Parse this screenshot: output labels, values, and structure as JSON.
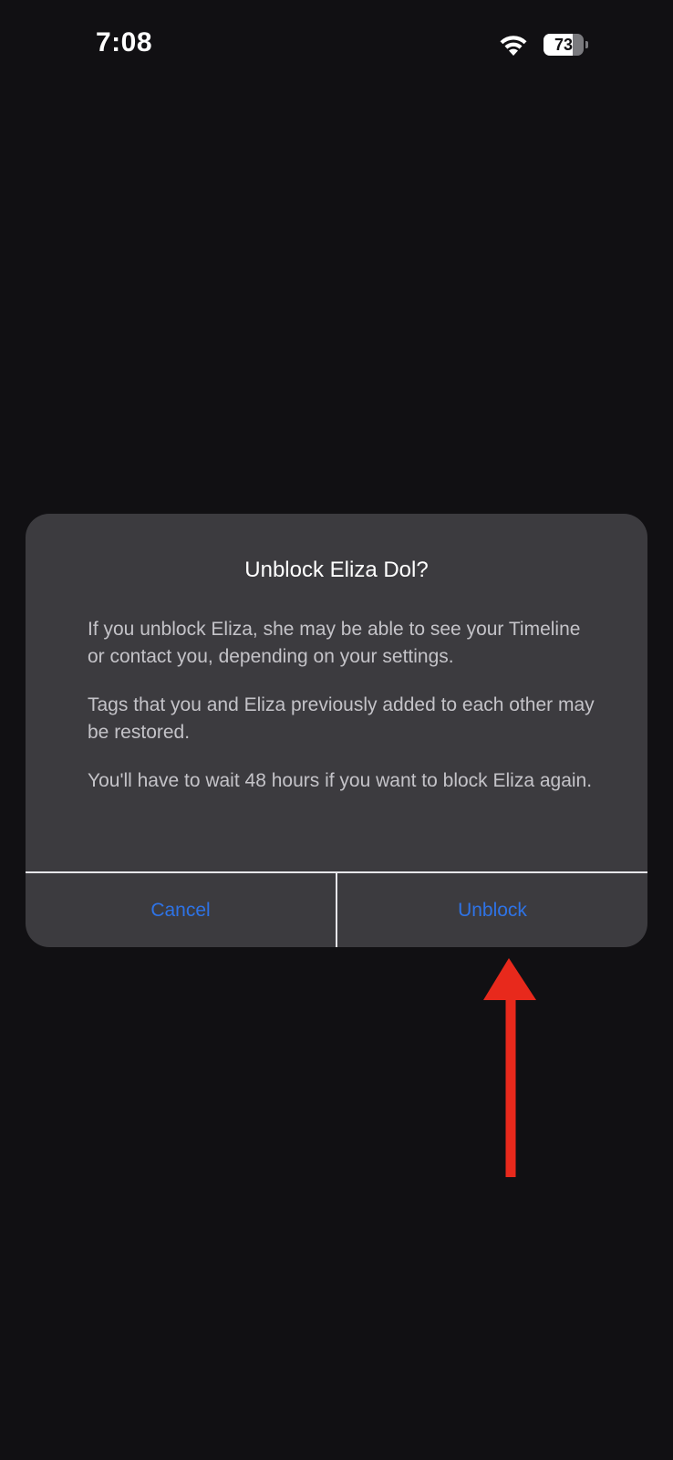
{
  "status_bar": {
    "time": "7:08",
    "battery_level": "73",
    "battery_fraction": 0.73
  },
  "alert": {
    "title": "Unblock Eliza Dol?",
    "paragraphs": [
      "If you unblock Eliza, she may be able to see your Timeline or contact you, depending on your settings.",
      "Tags that you and Eliza previously added to each other may be restored.",
      "You'll have to wait 48 hours if you want to block Eliza again."
    ],
    "cancel_label": "Cancel",
    "unblock_label": "Unblock"
  },
  "colors": {
    "background": "#111013",
    "alert_background": "#3c3b3f",
    "button_text": "#2e73e6",
    "annotation_arrow": "#e8291c"
  },
  "icons": [
    "wifi-icon",
    "battery-icon",
    "arrow-up-annotation-icon"
  ]
}
